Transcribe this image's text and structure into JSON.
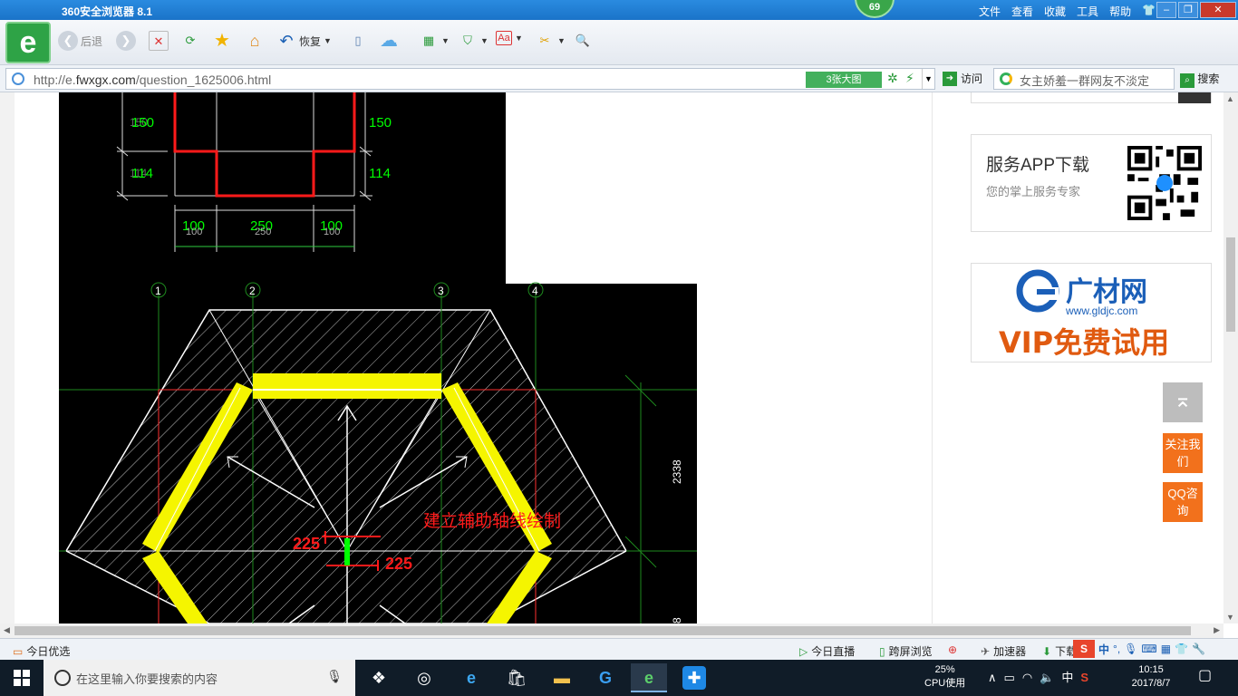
{
  "window": {
    "title": "360安全浏览器 8.1",
    "badge": "69",
    "menu": [
      "文件",
      "查看",
      "收藏",
      "工具",
      "帮助"
    ]
  },
  "toolbar": {
    "back_label": "后退",
    "restore_label": "恢复"
  },
  "address": {
    "url_prefix": "http://e.",
    "url_domain": "fwxgx.com",
    "url_path": "/question_1625006.html",
    "bigimg_label": "3张大图",
    "visit_label": "访问",
    "search_value": "女主娇羞一群网友不淡定",
    "search_label": "搜索"
  },
  "drawing": {
    "dims_top_left": [
      "150",
      "114"
    ],
    "dims_top_right": [
      "150",
      "114"
    ],
    "dims_bottom": [
      "100",
      "250",
      "100"
    ],
    "dims_bottom_shadow": [
      "100",
      "250",
      "100"
    ],
    "axis_labels": [
      "1",
      "2",
      "3",
      "4"
    ],
    "right_dim": "2338",
    "right_dim2": "8",
    "annotation": "建立辅助轴线绘制",
    "dim_left": "225",
    "dim_right": "225"
  },
  "sidebar": {
    "app_title": "服务APP下载",
    "app_subtitle": "您的掌上服务专家",
    "ad_logo_text": "广材网",
    "ad_logo_url": "www.gldjc.com",
    "ad_slogan": "VIP免费试用"
  },
  "float": {
    "top_icon": "back-to-top-icon",
    "follow_label": "关注我们",
    "qq_label": "QQ咨询"
  },
  "statusbar": {
    "today_pick": "今日优选",
    "live": "今日直播",
    "cross_screen": "跨屏浏览",
    "accelerator": "加速器",
    "download": "下载",
    "ime_cn": "中"
  },
  "taskbar": {
    "search_placeholder": "在这里输入你要搜索的内容",
    "cpu_percent": "25%",
    "cpu_label": "CPU使用",
    "ime": "中",
    "time": "10:15",
    "date": "2017/8/7"
  },
  "colors": {
    "title_blue": "#1a73c8",
    "cad_bg": "#000000",
    "accent_orange": "#f2711c",
    "highlight_yellow": "#f5f500",
    "dim_green": "#00ff00",
    "dim_red": "#ff1a1a"
  }
}
